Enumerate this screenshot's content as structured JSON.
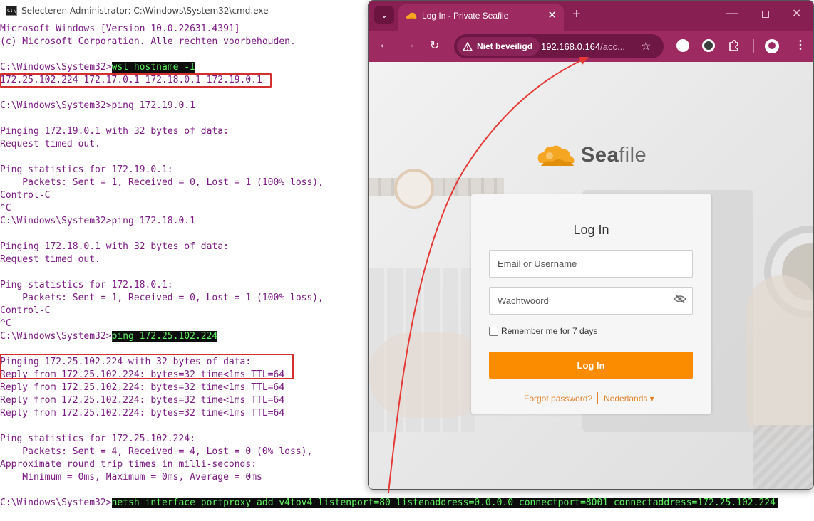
{
  "cmd": {
    "title": "Selecteren Administrator: C:\\Windows\\System32\\cmd.exe",
    "icon_text": "C:\\",
    "lines": [
      {
        "text": "Microsoft Windows [Version 10.0.22631.4391]"
      },
      {
        "text": "(c) Microsoft Corporation. Alle rechten voorbehouden."
      },
      {
        "text": ""
      },
      {
        "prompt": "C:\\Windows\\System32>",
        "cmd": "wsl hostname -I"
      },
      {
        "text": "172.25.102.224 172.17.0.1 172.18.0.1 172.19.0.1"
      },
      {
        "text": ""
      },
      {
        "text": "C:\\Windows\\System32>ping 172.19.0.1"
      },
      {
        "text": ""
      },
      {
        "text": "Pinging 172.19.0.1 with 32 bytes of data:"
      },
      {
        "text": "Request timed out."
      },
      {
        "text": ""
      },
      {
        "text": "Ping statistics for 172.19.0.1:"
      },
      {
        "text": "    Packets: Sent = 1, Received = 0, Lost = 1 (100% loss),"
      },
      {
        "text": "Control-C"
      },
      {
        "text": "^C"
      },
      {
        "text": "C:\\Windows\\System32>ping 172.18.0.1"
      },
      {
        "text": ""
      },
      {
        "text": "Pinging 172.18.0.1 with 32 bytes of data:"
      },
      {
        "text": "Request timed out."
      },
      {
        "text": ""
      },
      {
        "text": "Ping statistics for 172.18.0.1:"
      },
      {
        "text": "    Packets: Sent = 1, Received = 0, Lost = 1 (100% loss),"
      },
      {
        "text": "Control-C"
      },
      {
        "text": "^C"
      },
      {
        "prompt": "C:\\Windows\\System32>",
        "cmd": "ping 172.25.102.224"
      },
      {
        "text": ""
      },
      {
        "text": "Pinging 172.25.102.224 with 32 bytes of data:"
      },
      {
        "text": "Reply from 172.25.102.224: bytes=32 time<1ms TTL=64"
      },
      {
        "text": "Reply from 172.25.102.224: bytes=32 time<1ms TTL=64"
      },
      {
        "text": "Reply from 172.25.102.224: bytes=32 time<1ms TTL=64"
      },
      {
        "text": "Reply from 172.25.102.224: bytes=32 time<1ms TTL=64"
      },
      {
        "text": ""
      },
      {
        "text": "Ping statistics for 172.25.102.224:"
      },
      {
        "text": "    Packets: Sent = 4, Received = 4, Lost = 0 (0% loss),"
      },
      {
        "text": "Approximate round trip times in milli-seconds:"
      },
      {
        "text": "    Minimum = 0ms, Maximum = 0ms, Average = 0ms"
      },
      {
        "text": ""
      },
      {
        "prompt": "C:\\Windows\\System32>",
        "cmd": "netsh interface portproxy add v4tov4 listenport=80 listenaddress=0.0.0.0 connectport=8001 connectaddress=172.25.102.224"
      }
    ]
  },
  "browser": {
    "tab_title": "Log In - Private Seafile",
    "tab_close": "✕",
    "new_tab": "+",
    "dropdown": "⌄",
    "win_min": "—",
    "win_close": "✕",
    "nav": {
      "back": "←",
      "forward": "→",
      "reload": "↻"
    },
    "security_label": "Niet beveiligd",
    "url_host": "192.168.0.164",
    "url_rest": "/acc...",
    "star": "☆",
    "menu": "⋮",
    "colors": {
      "frame": "#871f53",
      "toolbar": "#9e2a62",
      "accent": "#fb8c00"
    }
  },
  "login": {
    "logo_prefix": "Sea",
    "logo_suffix": "file",
    "title": "Log In",
    "email_placeholder": "Email or Username",
    "password_placeholder": "Wachtwoord",
    "remember_label": "Remember me for 7 days",
    "button_label": "Log In",
    "forgot_link": "Forgot password?",
    "language": "Nederlands ▾"
  }
}
